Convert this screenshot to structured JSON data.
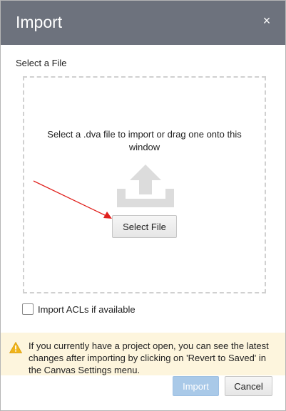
{
  "dialog": {
    "title": "Import",
    "close_label": "×"
  },
  "file_section": {
    "label": "Select a File",
    "drop_text": "Select a .dva file to import or drag one onto this window",
    "upload_icon": "upload-tray-icon",
    "select_button_label": "Select File"
  },
  "options": {
    "import_acls_label": "Import ACLs if available",
    "import_acls_checked": false
  },
  "warning": {
    "icon": "warning-triangle-icon",
    "text": "If you currently have a project open, you can see the latest changes after importing by clicking on 'Revert to Saved' in the Canvas Settings menu."
  },
  "footer": {
    "import_label": "Import",
    "cancel_label": "Cancel"
  },
  "colors": {
    "titlebar": "#6d727d",
    "warning_bg": "#fdf5dd",
    "primary_disabled": "#a9c9e8",
    "annotation_arrow": "#e0201c"
  }
}
